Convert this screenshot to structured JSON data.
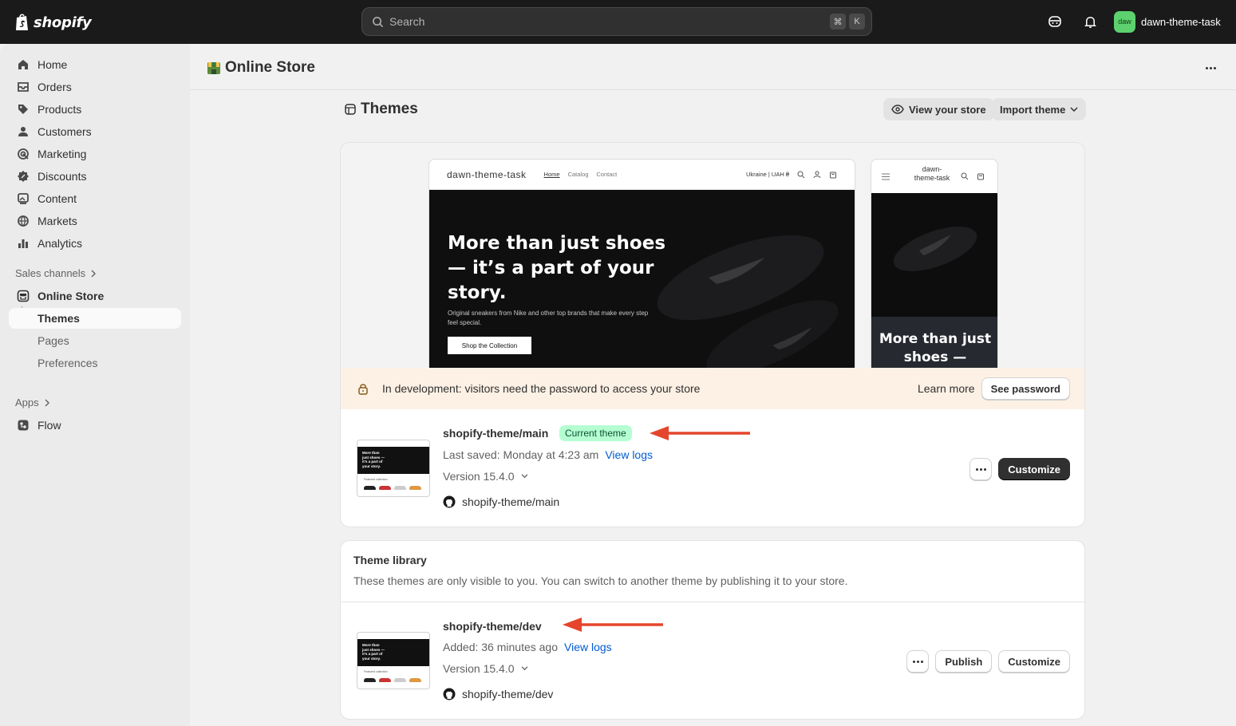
{
  "topbar": {
    "logo_text": "shopify",
    "search_placeholder": "Search",
    "kbd_cmd": "⌘",
    "kbd_k": "K",
    "store_initials": "daw",
    "store_name": "dawn-theme-task"
  },
  "sidebar": {
    "items": [
      {
        "label": "Home",
        "icon": "home-icon"
      },
      {
        "label": "Orders",
        "icon": "orders-icon"
      },
      {
        "label": "Products",
        "icon": "tag-icon"
      },
      {
        "label": "Customers",
        "icon": "person-icon"
      },
      {
        "label": "Marketing",
        "icon": "target-icon"
      },
      {
        "label": "Discounts",
        "icon": "discount-icon"
      },
      {
        "label": "Content",
        "icon": "image-icon"
      },
      {
        "label": "Markets",
        "icon": "globe-icon"
      },
      {
        "label": "Analytics",
        "icon": "bar-chart-icon"
      }
    ],
    "sales_channels_label": "Sales channels",
    "online_store": "Online Store",
    "sub_items": [
      "Themes",
      "Pages",
      "Preferences"
    ],
    "apps_label": "Apps",
    "flow": "Flow"
  },
  "header": {
    "title": "Online Store"
  },
  "themes": {
    "title": "Themes",
    "view_store": "View your store",
    "import_theme": "Import theme"
  },
  "preview": {
    "desk_brand": "dawn-theme-task",
    "nav_links": [
      "Home",
      "Catalog",
      "Contact"
    ],
    "locale": "Ukraine | UAH ₴",
    "hero_heading": "More than just shoes — it’s a part of your story.",
    "hero_sub": "Original sneakers from Nike and other top brands that make every step feel special.",
    "hero_button": "Shop the Collection",
    "mob_brand": "dawn-theme-task",
    "mob_heading": "More than just shoes —"
  },
  "banner": {
    "text": "In development: visitors need the password to access your store",
    "learn_more": "Learn more",
    "see_password": "See password"
  },
  "current_theme": {
    "name": "shopify-theme/main",
    "badge": "Current theme",
    "saved_label": "Last saved: Monday at 4:23 am",
    "view_logs": "View logs",
    "version": "Version 15.4.0",
    "repo": "shopify-theme/main",
    "customize": "Customize",
    "thumb_text": "More than just shoes — it's a part of your story.",
    "thumb_label": "Featured collection"
  },
  "library": {
    "title": "Theme library",
    "description": "These themes are only visible to you. You can switch to another theme by publishing it to your store.",
    "theme": {
      "name": "shopify-theme/dev",
      "added_label": "Added: 36 minutes ago",
      "view_logs": "View logs",
      "version": "Version 15.4.0",
      "repo": "shopify-theme/dev",
      "publish": "Publish",
      "customize": "Customize",
      "thumb_text": "More than just shoes — it's a part of your story.",
      "thumb_label": "Featured collection"
    }
  },
  "colors": {
    "topbar": "#1a1a1a",
    "badge_bg": "#b4fed2",
    "banner_bg": "#fdf1e5",
    "link": "#005bd3",
    "annotation_arrow": "#e5452d"
  }
}
